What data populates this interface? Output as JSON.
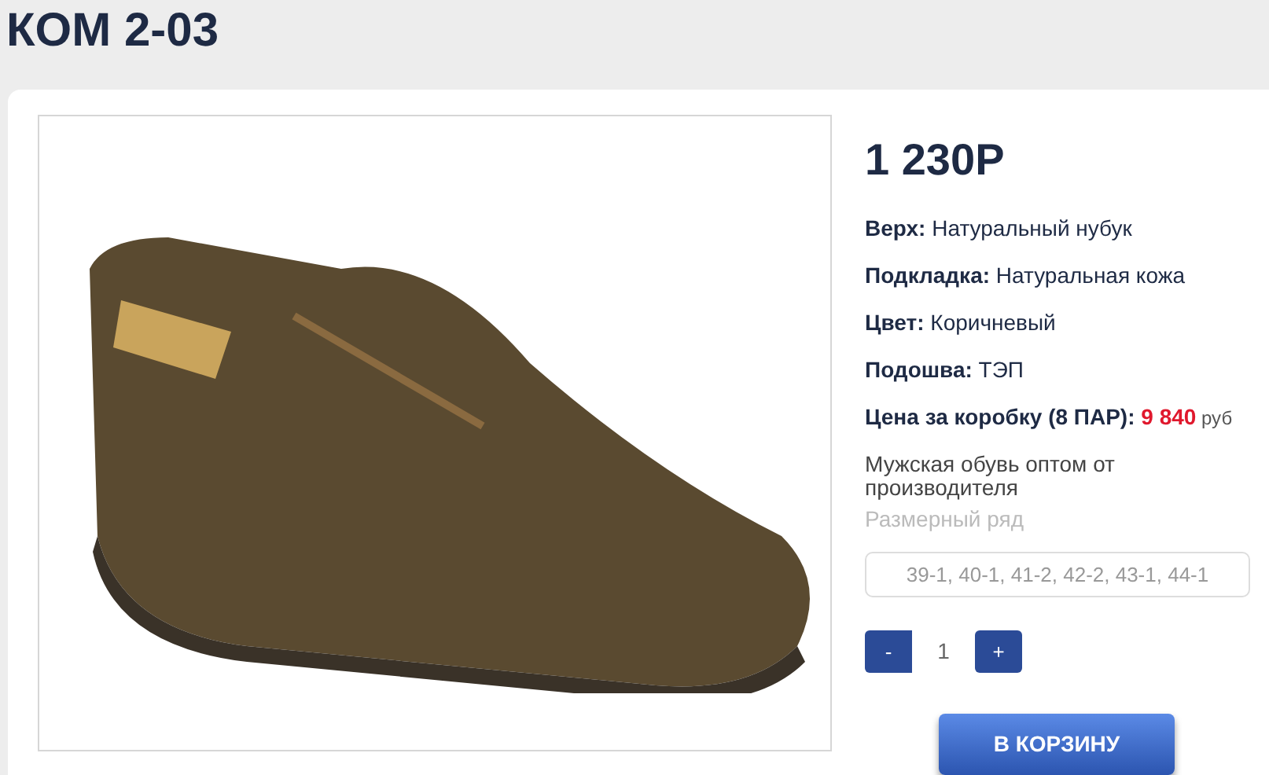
{
  "title": "КОМ 2-03",
  "price": "1 230Р",
  "specs": [
    {
      "label": "Верх:",
      "value": "Натуральный нубук"
    },
    {
      "label": "Подкладка:",
      "value": "Натуральная кожа"
    },
    {
      "label": "Цвет:",
      "value": "Коричневый"
    },
    {
      "label": "Подошва:",
      "value": "ТЭП"
    }
  ],
  "box_price": {
    "label": "Цена за коробку (8 ПАР):",
    "value": "9 840",
    "unit": "руб"
  },
  "description": "Мужская обувь оптом от производителя",
  "size_range": {
    "label": "Размерный ряд",
    "placeholder": "39-1, 40-1, 41-2, 42-2, 43-1, 44-1"
  },
  "quantity": {
    "minus": "-",
    "value": "1",
    "plus": "+"
  },
  "cart_button": "В КОРЗИНУ"
}
